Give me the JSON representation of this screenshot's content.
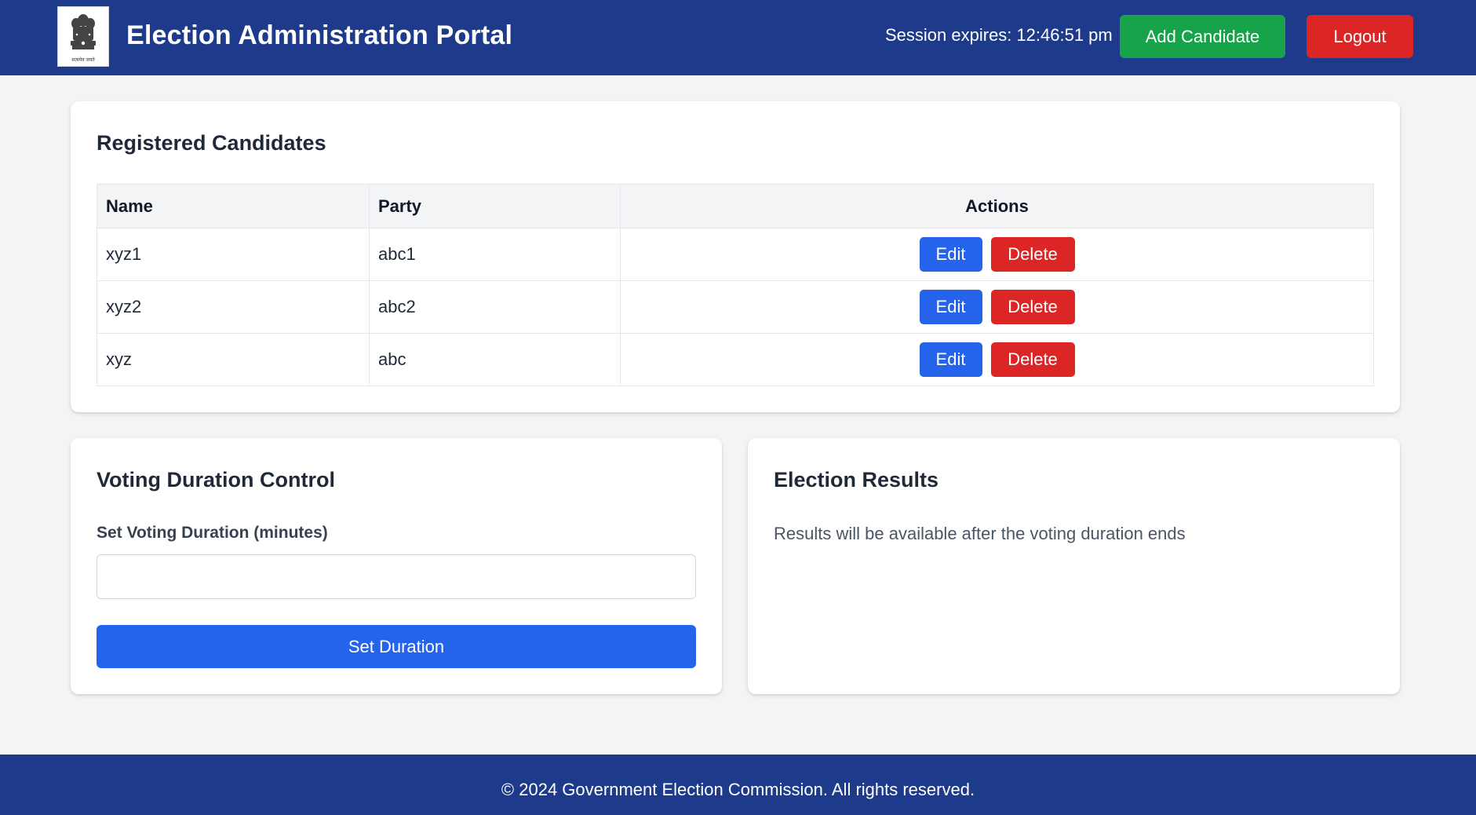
{
  "header": {
    "emblem_caption": "सत्यमेव जयते",
    "title": "Election Administration Portal",
    "session_label": "Session expires:",
    "session_time": "12:46:51 pm",
    "add_candidate_label": "Add Candidate",
    "logout_label": "Logout"
  },
  "candidates": {
    "title": "Registered Candidates",
    "columns": [
      "Name",
      "Party",
      "Actions"
    ],
    "rows": [
      {
        "name": "xyz1",
        "party": "abc1"
      },
      {
        "name": "xyz2",
        "party": "abc2"
      },
      {
        "name": "xyz",
        "party": "abc"
      }
    ],
    "edit_label": "Edit",
    "delete_label": "Delete"
  },
  "duration": {
    "title": "Voting Duration Control",
    "field_label": "Set Voting Duration (minutes)",
    "input_value": "",
    "button_label": "Set Duration"
  },
  "results": {
    "title": "Election Results",
    "message": "Results will be available after the voting duration ends"
  },
  "footer": {
    "text": "© 2024 Government Election Commission. All rights reserved."
  },
  "colors": {
    "header_bg": "#1e3a8a",
    "success": "#16a34a",
    "danger": "#dc2626",
    "primary": "#2563eb"
  }
}
